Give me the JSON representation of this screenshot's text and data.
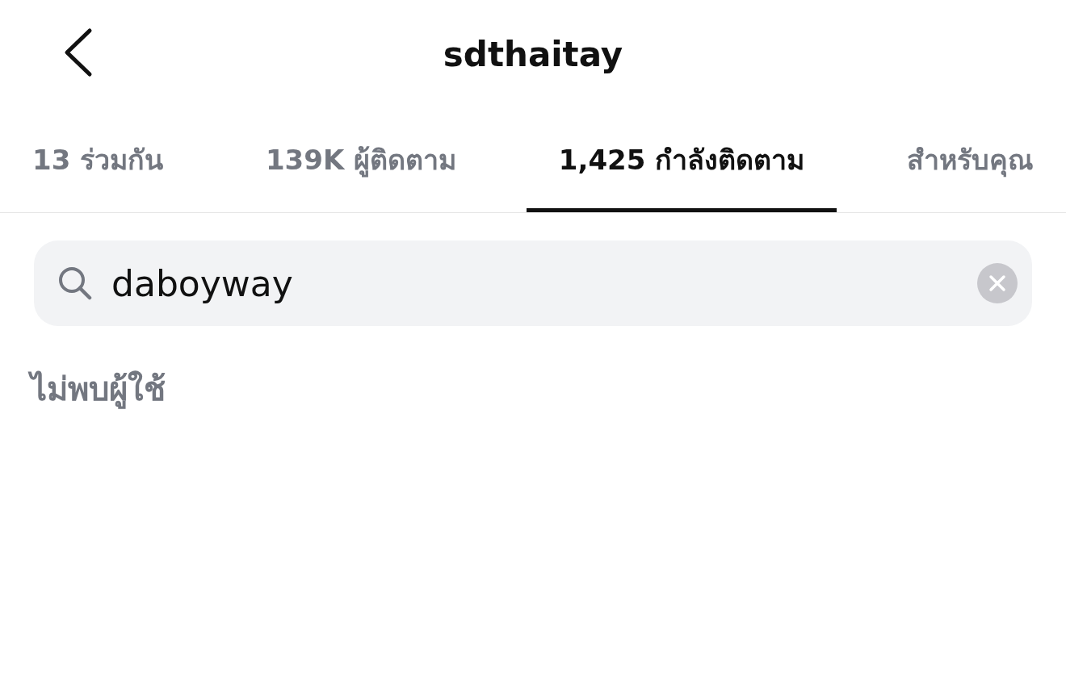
{
  "header": {
    "title": "sdthaitay"
  },
  "tabs": [
    {
      "label": "13 ร่วมกัน",
      "selected": false
    },
    {
      "label": "139K ผู้ติดตาม",
      "selected": false
    },
    {
      "label": "1,425 กำลังติดตาม",
      "selected": true
    },
    {
      "label": "สำหรับคุณ",
      "selected": false
    }
  ],
  "search": {
    "value": "daboyway"
  },
  "empty_message": "ไม่พบผู้ใช้"
}
